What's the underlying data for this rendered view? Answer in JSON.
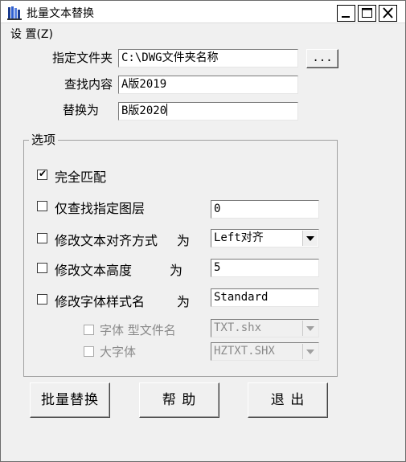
{
  "window": {
    "title": "批量文本替换"
  },
  "menu": {
    "settings": "设 置(Z)"
  },
  "fields": {
    "folder": {
      "label": "指定文件夹",
      "value": "C:\\DWG文件夹名称",
      "browse_label": "..."
    },
    "find": {
      "label": "查找内容",
      "value": "A版2019"
    },
    "replace": {
      "label": "替换为",
      "value": "B版2020"
    }
  },
  "options": {
    "title": "选项",
    "exact_match": {
      "label": "完全匹配",
      "checked": true
    },
    "layer": {
      "label": "仅查找指定图层",
      "checked": false,
      "value": "0"
    },
    "align": {
      "label": "修改文本对齐方式",
      "suffix": "为",
      "checked": false,
      "value": "Left对齐"
    },
    "height": {
      "label": "修改文本高度",
      "suffix": "为",
      "checked": false,
      "value": "5"
    },
    "style": {
      "label": "修改字体样式名",
      "suffix": "为",
      "checked": false,
      "value": "Standard"
    },
    "font_type": {
      "label": "字体 型文件名",
      "checked": false,
      "enabled": false,
      "value": "TXT.shx"
    },
    "big_font": {
      "label": "大字体",
      "checked": false,
      "enabled": false,
      "value": "HZTXT.SHX"
    }
  },
  "buttons": {
    "replace_all": "批量替换",
    "help": "帮 助",
    "exit": "退 出"
  },
  "colors": {
    "title_bg": "#ffffff",
    "window_bg": "#f0f0f0",
    "disabled_text": "#8a8a8a"
  }
}
